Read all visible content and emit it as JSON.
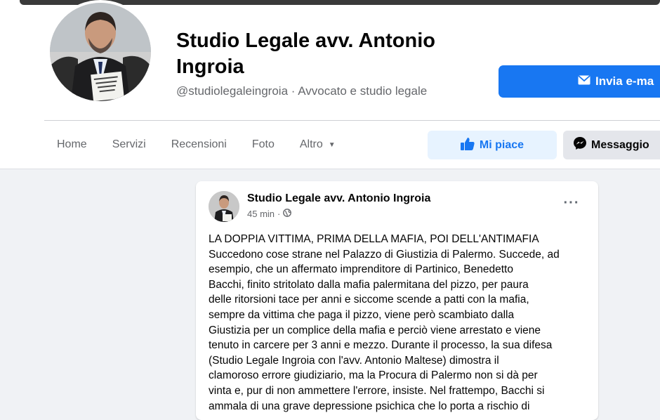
{
  "page": {
    "title": "Studio Legale avv. Antonio Ingroia",
    "handle": "@studiolegaleingroia",
    "category": "Avvocato e studio legale"
  },
  "actions": {
    "email_label": "Invia e-ma",
    "like_label": "Mi piace",
    "message_label": "Messaggio"
  },
  "tabs": [
    {
      "label": "Home"
    },
    {
      "label": "Servizi"
    },
    {
      "label": "Recensioni"
    },
    {
      "label": "Foto"
    },
    {
      "label": "Altro"
    }
  ],
  "post": {
    "author": "Studio Legale avv. Antonio Ingroia",
    "time": "45 min",
    "separator": "·",
    "lines": [
      "LA DOPPIA VITTIMA, PRIMA DELLA MAFIA, POI DELL'ANTIMAFIA",
      "Succedono cose strane nel Palazzo di Giustizia di Palermo. Succede, ad",
      "esempio, che un affermato imprenditore di Partinico, Benedetto",
      "Bacchi, finito stritolato dalla mafia palermitana del pizzo, per paura",
      "delle ritorsioni tace per anni e siccome scende a patti con la mafia,",
      "sempre da vittima che paga il pizzo, viene però scambiato dalla",
      "Giustizia per un complice della mafia e perciò viene arrestato e viene",
      "tenuto in carcere per 3 anni e mezzo. Durante il processo, la sua difesa",
      "(Studio Legale Ingroia con l'avv. Antonio Maltese) dimostra il",
      "clamoroso errore giudiziario, ma la Procura di Palermo non si dà per",
      "vinta e, pur di non ammettere l'errore, insiste. Nel frattempo, Bacchi si",
      "ammala di una grave depressione psichica che lo porta a rischio di"
    ]
  },
  "colors": {
    "accent": "#1877f2",
    "background": "#f0f2f5",
    "secondary_text": "#65676b"
  },
  "icons": [
    "envelope-icon",
    "thumbs-up-icon",
    "messenger-icon",
    "globe-icon",
    "more-icon",
    "caret-down-icon"
  ]
}
